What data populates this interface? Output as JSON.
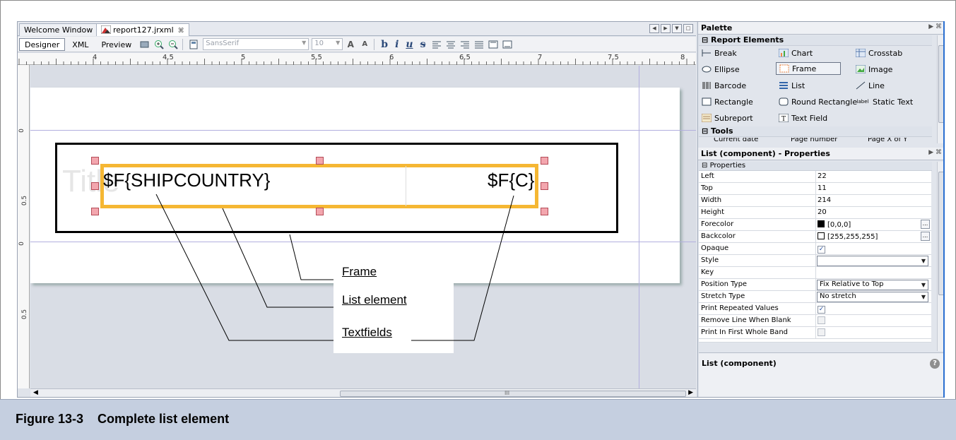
{
  "editor": {
    "tabs": [
      {
        "label": "Welcome Window",
        "close": "⌘"
      },
      {
        "label": "report127.jrxml",
        "close": "⌘"
      }
    ],
    "modes": [
      "Designer",
      "XML",
      "Preview"
    ],
    "font_family": "SansSerif",
    "font_size": "10",
    "format_glyphs": [
      "b",
      "i",
      "u",
      "s"
    ]
  },
  "ruler": {
    "labels": [
      "4",
      "4.5",
      "5",
      "5.5",
      "6",
      "6.5",
      "7",
      "7.5",
      "8"
    ],
    "vertical_labels": [
      "0",
      "0.5",
      "0",
      "0.5"
    ]
  },
  "canvas": {
    "title_ghost": "Title",
    "textfield_1": "$F{SHIPCOUNTRY}",
    "textfield_2": "$F{C}",
    "scroll_grip": "III"
  },
  "callouts": {
    "frame": "Frame",
    "list_element": "List element",
    "textfields": "Textfields"
  },
  "palette": {
    "title": "Palette",
    "section_elements": "Report Elements",
    "items": [
      {
        "label": "Break",
        "icon": "break-icon"
      },
      {
        "label": "Chart",
        "icon": "chart-icon"
      },
      {
        "label": "Crosstab",
        "icon": "crosstab-icon"
      },
      {
        "label": "Ellipse",
        "icon": "ellipse-icon"
      },
      {
        "label": "Frame",
        "icon": "frame-icon",
        "selected": true
      },
      {
        "label": "Image",
        "icon": "image-icon"
      },
      {
        "label": "Barcode",
        "icon": "barcode-icon"
      },
      {
        "label": "List",
        "icon": "list-icon"
      },
      {
        "label": "Line",
        "icon": "line-icon"
      },
      {
        "label": "Rectangle",
        "icon": "rectangle-icon"
      },
      {
        "label": "Round Rectangle",
        "icon": "round-rectangle-icon"
      },
      {
        "label": "Static Text",
        "icon": "static-text-icon",
        "icon_text": "label"
      },
      {
        "label": "Subreport",
        "icon": "subreport-icon"
      },
      {
        "label": "Text Field",
        "icon": "text-field-icon"
      }
    ],
    "section_tools": "Tools",
    "tools_partial": [
      "Current date",
      "Page number",
      "Page X of Y"
    ]
  },
  "properties": {
    "title": "List (component) - Properties",
    "section": "Properties",
    "rows": [
      {
        "name": "Left",
        "value": "22"
      },
      {
        "name": "Top",
        "value": "11"
      },
      {
        "name": "Width",
        "value": "214"
      },
      {
        "name": "Height",
        "value": "20"
      },
      {
        "name": "Forecolor",
        "value": "[0,0,0]",
        "swatch": "#000000"
      },
      {
        "name": "Backcolor",
        "value": "[255,255,255]",
        "swatch": "#ffffff"
      },
      {
        "name": "Opaque",
        "checked": true
      },
      {
        "name": "Style",
        "value": ""
      },
      {
        "name": "Key",
        "value": ""
      },
      {
        "name": "Position Type",
        "value": "Fix Relative to Top"
      },
      {
        "name": "Stretch Type",
        "value": "No stretch"
      },
      {
        "name": "Print Repeated Values",
        "checked": true
      },
      {
        "name": "Remove Line When Blank",
        "checked": false
      },
      {
        "name": "Print In First Whole Band",
        "checked": false
      }
    ],
    "description_title": "List (component)"
  },
  "caption": {
    "number": "Figure 13-3",
    "text": "Complete list element"
  },
  "colors": {
    "list_border": "#f5b733",
    "handle_fill": "#f3a6ae",
    "caption_bg": "#c5cfe0",
    "guide": "#b2afde"
  }
}
